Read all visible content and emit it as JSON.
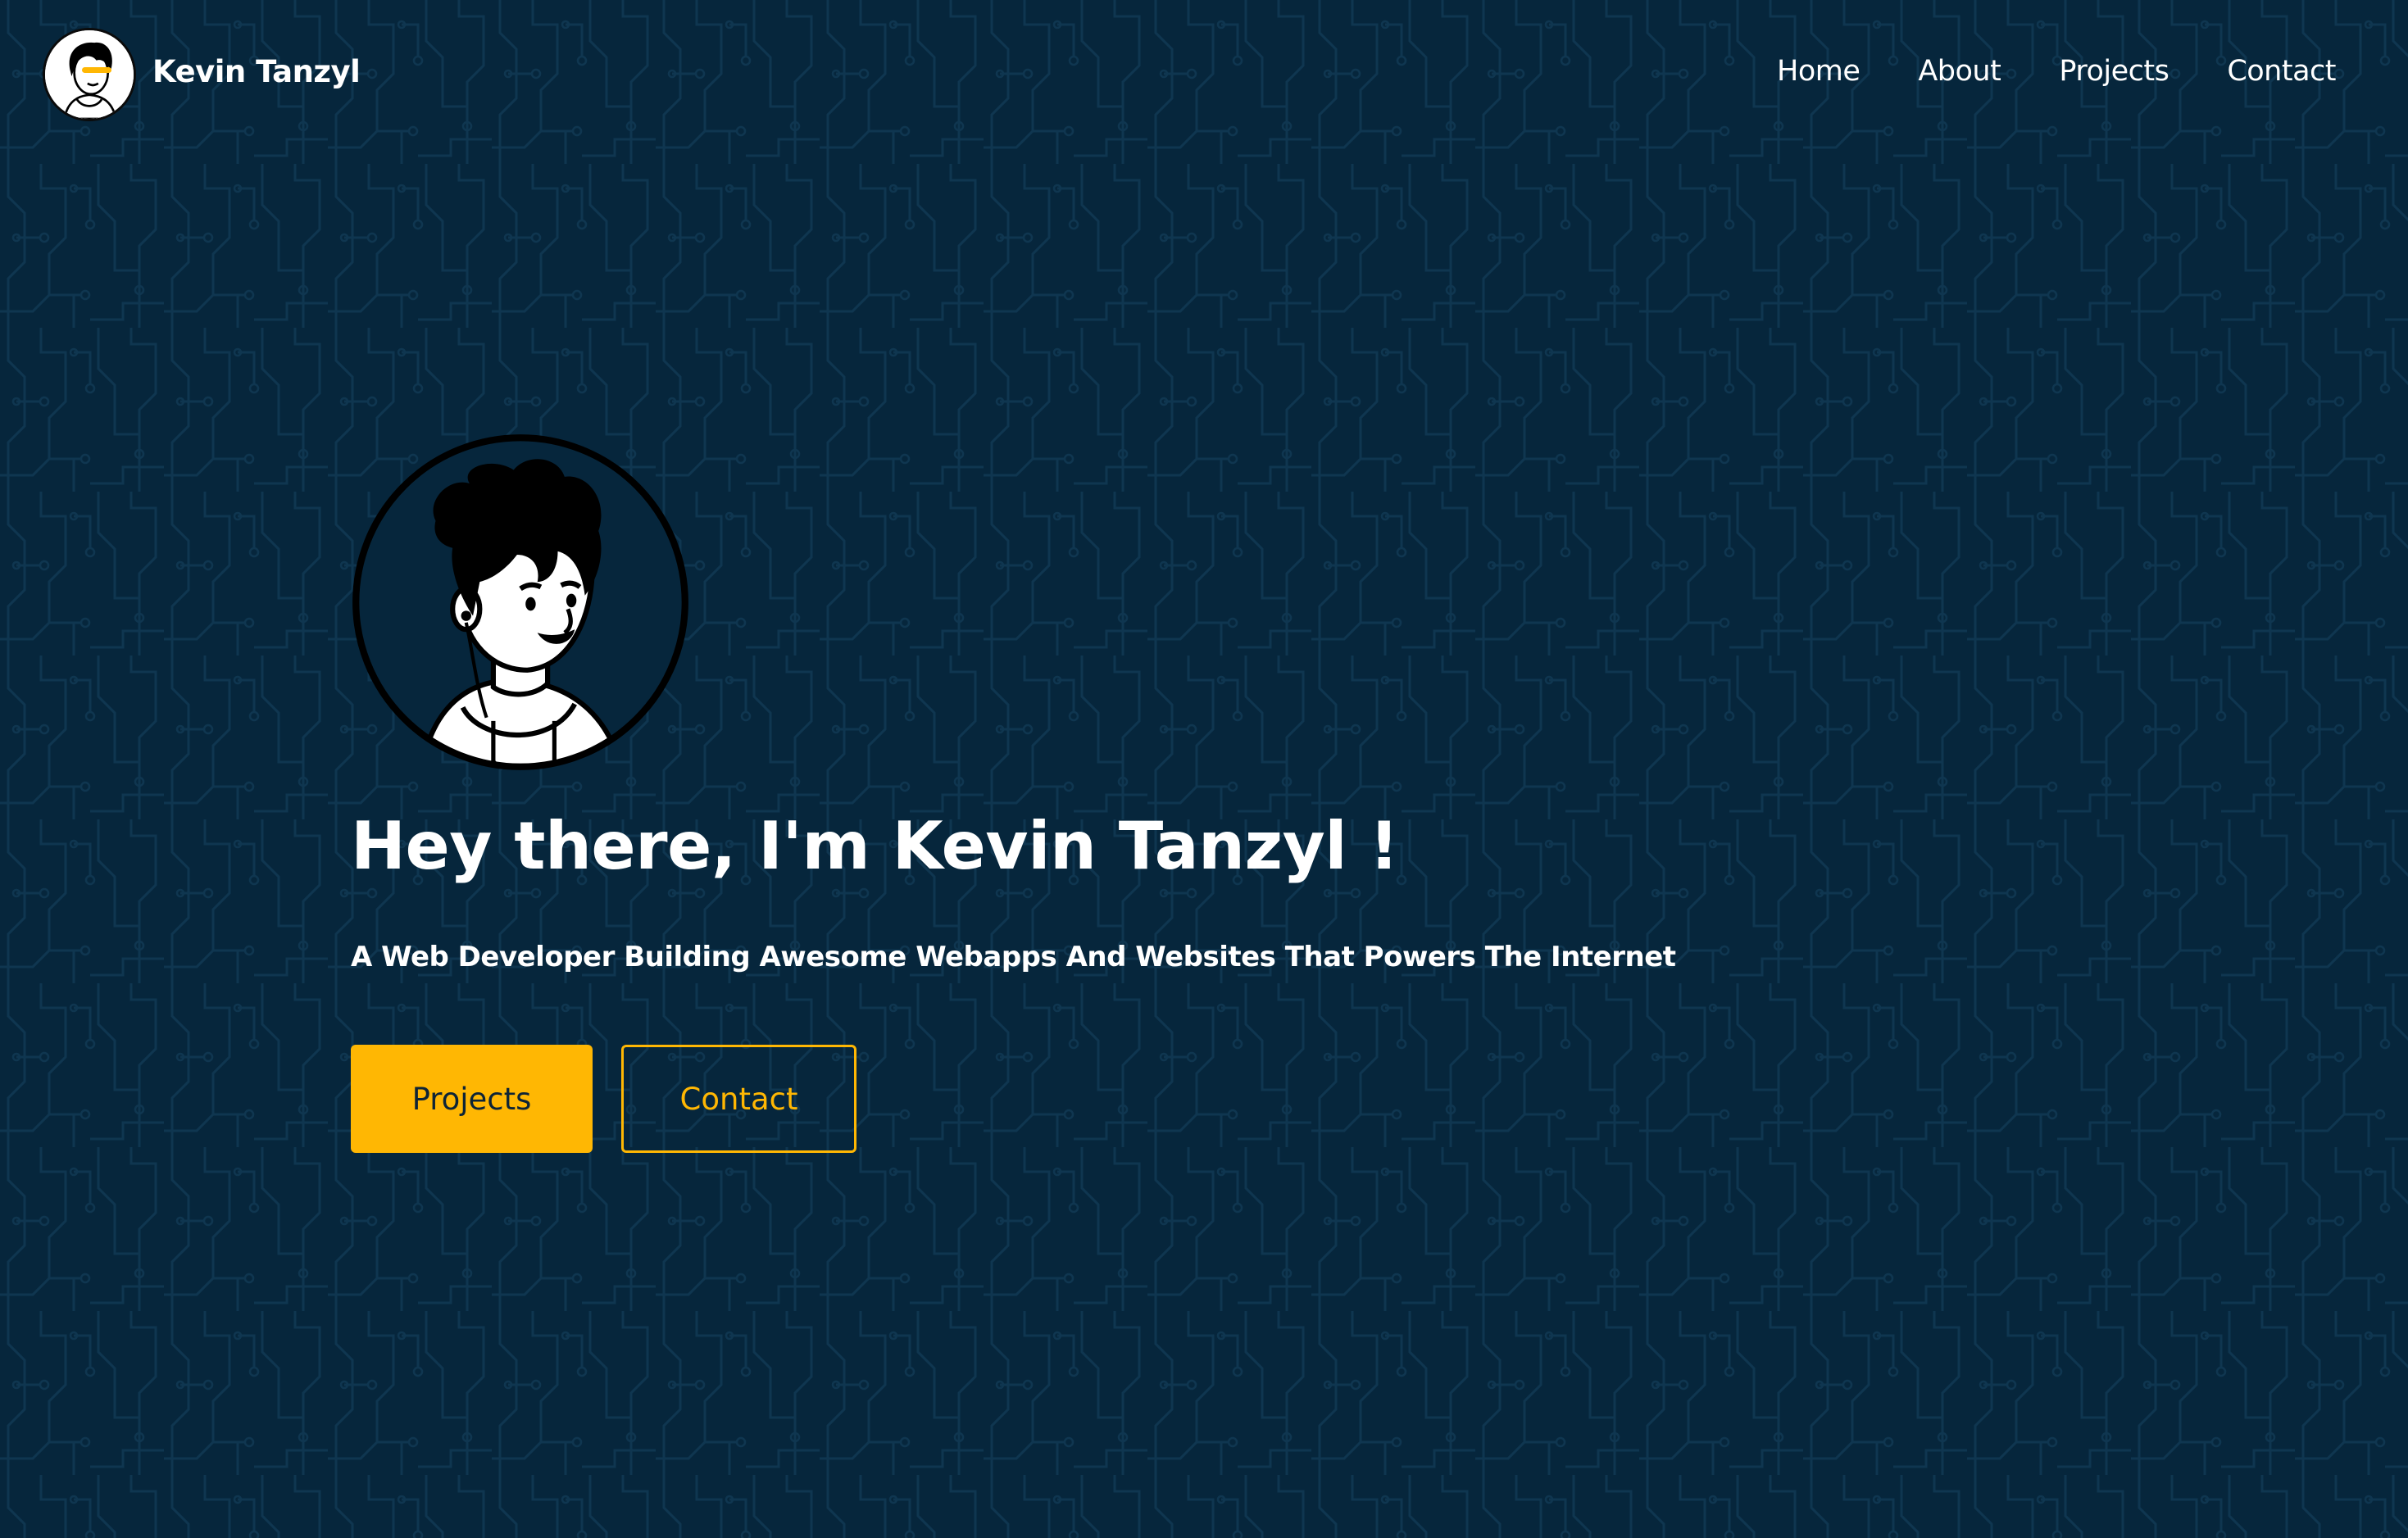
{
  "brand": {
    "name": "Kevin Tanzyl",
    "avatar_icon": "cartoon-avatar-icon"
  },
  "nav": {
    "items": [
      {
        "label": "Home"
      },
      {
        "label": "About"
      },
      {
        "label": "Projects"
      },
      {
        "label": "Contact"
      }
    ]
  },
  "hero": {
    "avatar_icon": "cartoon-avatar-icon",
    "title": "Hey there, I'm Kevin Tanzyl !",
    "subtitle": "A Web Developer Building Awesome Webapps And Websites That Powers The Internet",
    "primary_button": "Projects",
    "secondary_button": "Contact"
  },
  "colors": {
    "background": "#06263c",
    "circuit_pattern": "#0e3349",
    "accent": "#ffb703",
    "text": "#ffffff",
    "button_text_dark": "#0e2436"
  },
  "background_pattern_icon": "circuit-board-pattern"
}
